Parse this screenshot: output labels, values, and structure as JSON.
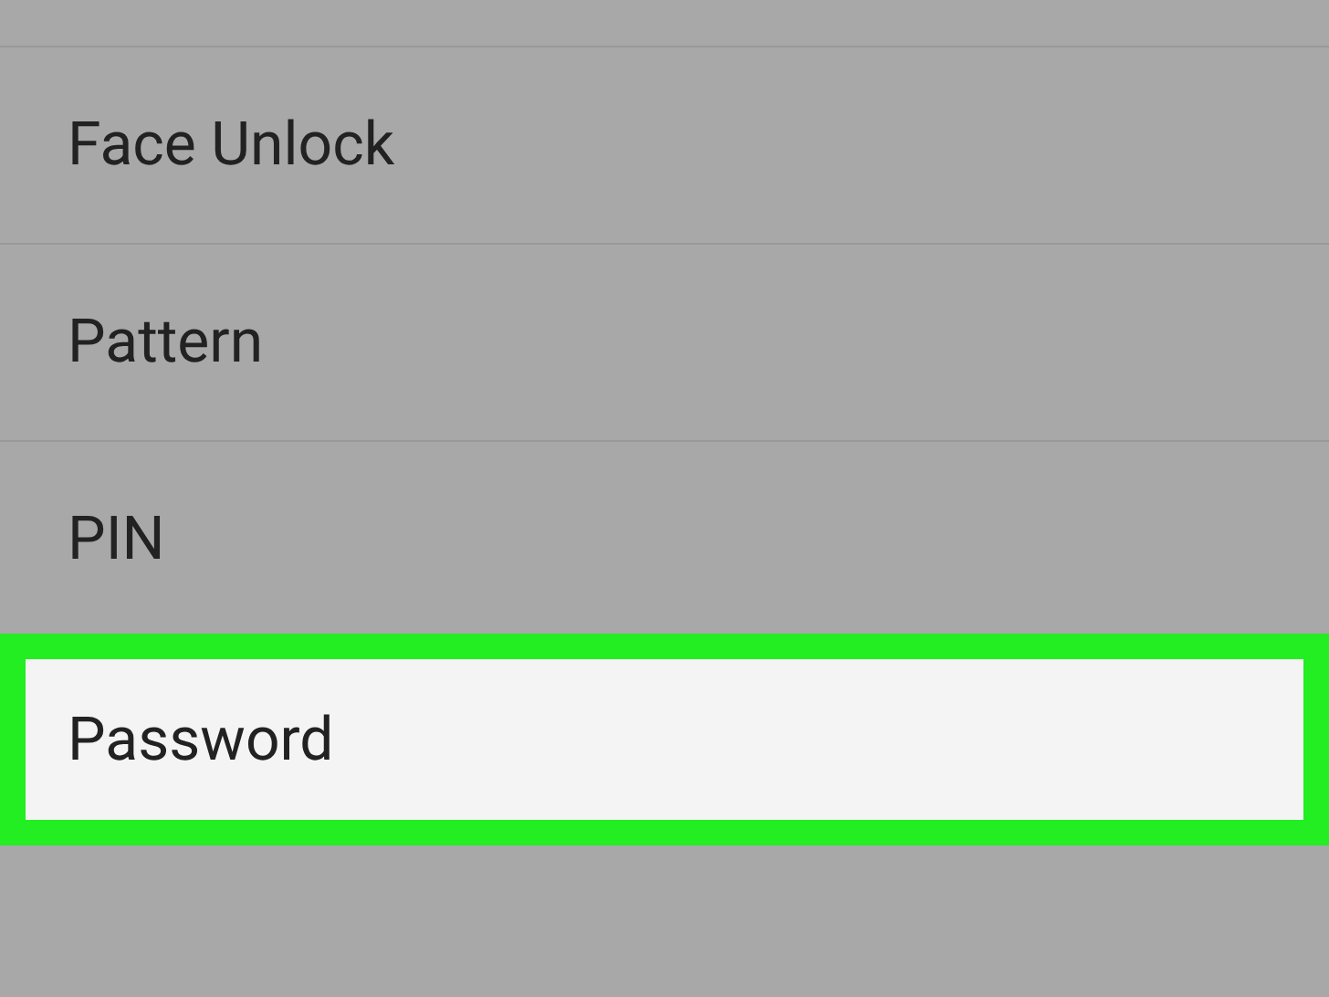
{
  "options": [
    {
      "label": "Face Unlock",
      "selected": false
    },
    {
      "label": "Pattern",
      "selected": false
    },
    {
      "label": "PIN",
      "selected": false
    },
    {
      "label": "Password",
      "selected": true
    }
  ]
}
